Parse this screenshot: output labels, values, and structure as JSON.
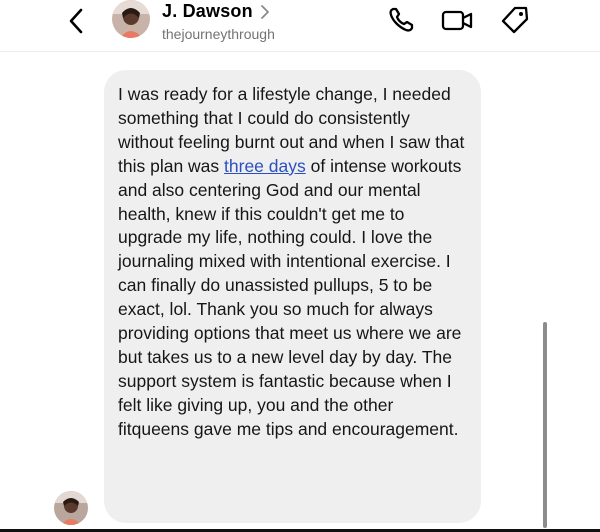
{
  "header": {
    "name": "J. Dawson",
    "handle": "thejourneythrough",
    "icons": [
      "back-arrow-icon",
      "phone-icon",
      "video-camera-icon",
      "tag-icon"
    ]
  },
  "message": {
    "before_link": "I was ready for a lifestyle change, I needed something that I could do consistently without feeling burnt out and when I saw that this plan was ",
    "link_text": "three days",
    "after_link": " of intense workouts and also centering God and our mental health, knew if this couldn't get me to upgrade my life, nothing could. I love the journaling mixed with intentional exercise. I can finally do unassisted pullups, 5 to be exact, lol. Thank you so much for always providing options that meet us where we are but takes us to a new level day by day. The support system is fantastic because when I felt like giving up, you and the other fitqueens gave me tips and encouragement."
  },
  "colors": {
    "bubble": "#efefef",
    "link": "#2b4fbf",
    "handle": "#737373"
  }
}
